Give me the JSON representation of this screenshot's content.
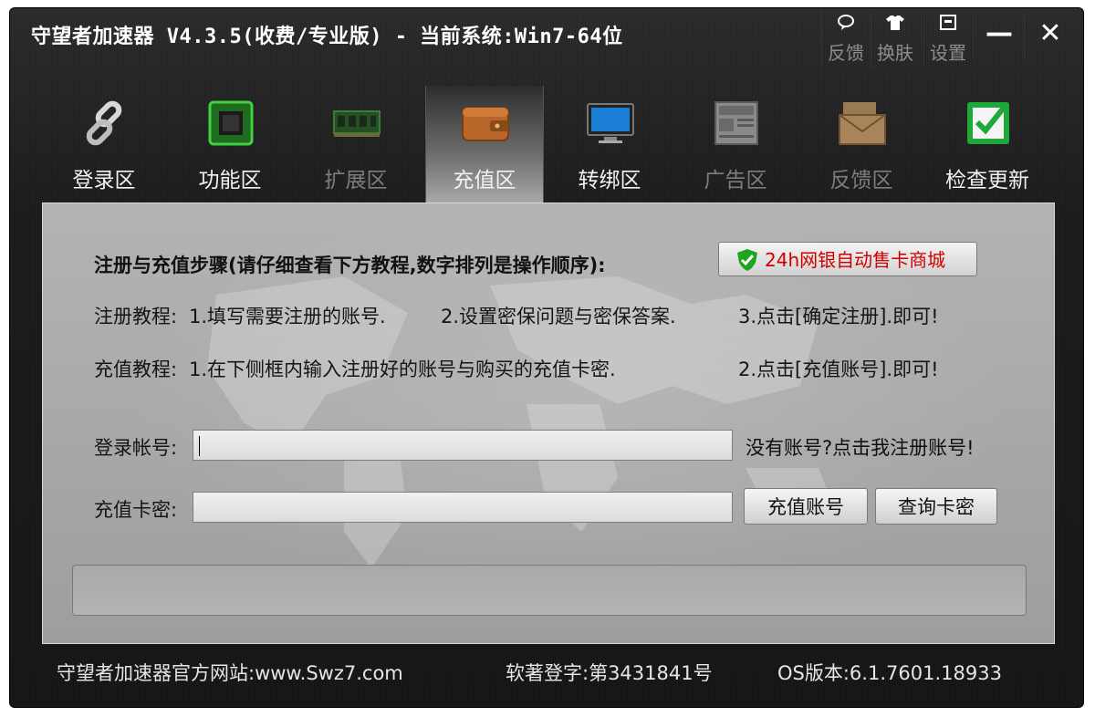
{
  "window": {
    "title": "守望者加速器 V4.3.5(收费/专业版) - 当前系统:Win7-64位",
    "top_buttons": [
      {
        "icon": "feedback-bubble-icon",
        "label": "反馈"
      },
      {
        "icon": "tshirt-icon",
        "label": "换肤"
      },
      {
        "icon": "settings-window-icon",
        "label": "设置"
      }
    ],
    "minimize": "—",
    "close": "✕"
  },
  "nav": {
    "tabs": [
      {
        "icon": "chain-link-icon",
        "label": "登录区"
      },
      {
        "icon": "chip-icon",
        "label": "功能区"
      },
      {
        "icon": "memory-board-icon",
        "label": "扩展区"
      },
      {
        "icon": "wallet-icon",
        "label": "充值区",
        "active": true
      },
      {
        "icon": "monitor-icon",
        "label": "转绑区"
      },
      {
        "icon": "newspaper-icon",
        "label": "广告区"
      },
      {
        "icon": "envelope-icon",
        "label": "反馈区"
      },
      {
        "icon": "check-update-icon",
        "label": "检查更新"
      }
    ]
  },
  "panel": {
    "steps_title": "注册与充值步骤(请仔细查看下方教程,数字排列是操作顺序):",
    "shop_button": "24h网银自动售卡商城",
    "register_tutorial": {
      "prefix": "注册教程:",
      "step1": "1.填写需要注册的账号.",
      "step2": "2.设置密保问题与密保答案.",
      "step3": "3.点击[确定注册].即可!"
    },
    "recharge_tutorial": {
      "prefix": "充值教程:",
      "step1": "1.在下侧框内输入注册好的账号与购买的充值卡密.",
      "step2": "2.点击[充值账号].即可!"
    },
    "account_label": "登录帐号:",
    "account_value": "",
    "register_link": "没有账号?点击我注册账号!",
    "card_label": "充值卡密:",
    "card_value": "",
    "recharge_button": "充值账号",
    "query_button": "查询卡密",
    "status_text": ""
  },
  "footer": {
    "website": "守望者加速器官方网站:www.Swz7.com",
    "copyright": "软著登字:第3431841号",
    "os_version": "OS版本:6.1.7601.18933"
  },
  "colors": {
    "window_bg": "#1b1b1b",
    "panel_bg": "#a8a8a8",
    "shop_text": "#d00000",
    "shield_green": "#1fa51f"
  }
}
